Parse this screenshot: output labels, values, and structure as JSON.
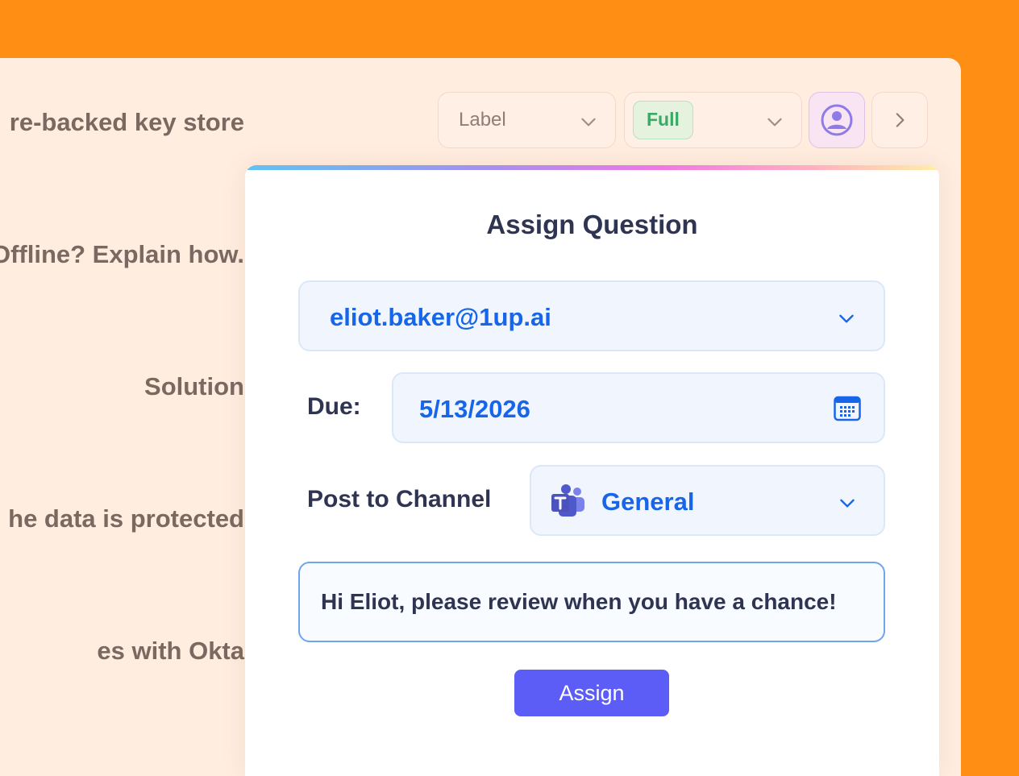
{
  "background": {
    "rows": [
      "re-backed key store",
      "Offline? Explain how.",
      "Solution",
      "he data is protected",
      "es with Okta"
    ]
  },
  "toolbar": {
    "label_select": {
      "value": "Label",
      "icon": "chevron-down-icon"
    },
    "status_select": {
      "value": "Full",
      "icon": "chevron-down-icon"
    },
    "assign_user_icon": "user-circle-icon",
    "next_icon": "chevron-right-icon"
  },
  "modal": {
    "title": "Assign Question",
    "assignee": {
      "value": "eliot.baker@1up.ai",
      "icon": "chevron-down-icon"
    },
    "due": {
      "label": "Due:",
      "value": "5/13/2026",
      "icon": "calendar-icon"
    },
    "channel": {
      "label": "Post to Channel",
      "value": "General",
      "app_icon": "microsoft-teams-icon",
      "icon": "chevron-down-icon"
    },
    "message": {
      "value": "Hi Eliot, please review when you have a chance!"
    },
    "submit_label": "Assign"
  },
  "colors": {
    "frame": "#FF8F14",
    "panel": "#FFEDE0",
    "accent_blue": "#1766EA",
    "button": "#5C5CF6",
    "badge_green": "#3AA866",
    "title_text": "#2E3452"
  }
}
